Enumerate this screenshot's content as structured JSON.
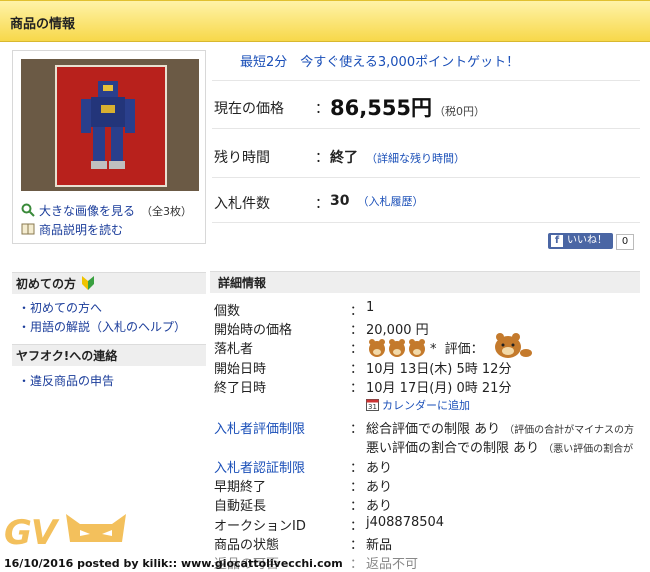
{
  "header": {
    "title": "商品の情報"
  },
  "thumb": {
    "view_large": "大きな画像を見る",
    "view_count": "（全3枚）",
    "read_desc": "商品説明を読む"
  },
  "promo": "最短2分　今すぐ使える3,000ポイントゲット！",
  "summary": {
    "price_label": "現在の価格",
    "price": "86,555円",
    "tax": "（税0円）",
    "time_label": "残り時間",
    "time_value": "終了",
    "time_link": "（詳細な残り時間）",
    "bids_label": "入札件数",
    "bids_value": "30",
    "bids_link": "（入札履歴）",
    "colon": "："
  },
  "facebook": {
    "label": "いいね！",
    "count": "0",
    "logo": "f"
  },
  "sidebar": {
    "beginner_title": "初めての方",
    "beginner_links": [
      "・初めての方へ",
      "・用語の解説（入札のヘルプ）"
    ],
    "contact_title": "ヤフオク!への連絡",
    "contact_links": [
      "・違反商品の申告"
    ]
  },
  "details": {
    "title": "詳細情報",
    "colon": "：",
    "rows": [
      {
        "label": "個数",
        "value": "1"
      },
      {
        "label": "開始時の価格",
        "value": "20,000 円"
      },
      {
        "label": "落札者",
        "value": "*",
        "rating_label": "評価："
      },
      {
        "label": "開始日時",
        "value": "10月 13日(木) 5時 12分"
      },
      {
        "label": "終了日時",
        "value": "10月 17日(月) 0時 21分"
      },
      {
        "label": "",
        "value": "カレンダーに追加"
      },
      {
        "label": "入札者評価制限",
        "value": "総合評価での制限 あり",
        "note": "（評価の合計がマイナスの方"
      },
      {
        "label": "",
        "value": "悪い評価の割合での制限 あり",
        "note": "（悪い評価の割合が"
      },
      {
        "label": "入札者認証制限",
        "value": "あり"
      },
      {
        "label": "早期終了",
        "value": "あり"
      },
      {
        "label": "自動延長",
        "value": "あり"
      },
      {
        "label": "オークションID",
        "value": "j408878504"
      },
      {
        "label": "商品の状態",
        "value": "新品"
      },
      {
        "label": "返品の可否",
        "value": "返品不可"
      }
    ]
  },
  "footer": {
    "watermark": "GV",
    "credit": "16/10/2016 posted by kilik:: www.giocattolivecchi.com"
  },
  "colors": {
    "header_yellow": "#f7d84a",
    "link_blue": "#1a4fb8",
    "fb_blue": "#4a66a4"
  }
}
